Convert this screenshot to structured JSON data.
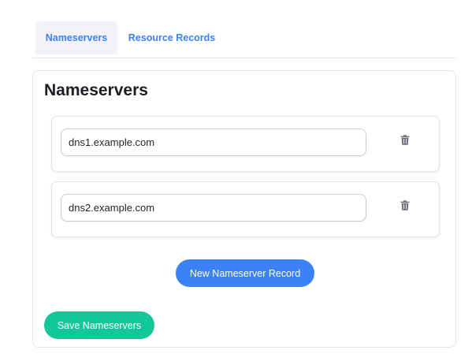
{
  "tabs": [
    {
      "label": "Nameservers",
      "active": true
    },
    {
      "label": "Resource Records",
      "active": false
    }
  ],
  "panel": {
    "title": "Nameservers",
    "records": [
      {
        "value": "dns1.example.com",
        "delete_icon": "trash-icon"
      },
      {
        "value": "dns2.example.com",
        "delete_icon": "trash-icon"
      }
    ],
    "new_button_label": "New Nameserver Record",
    "save_button_label": "Save Nameservers"
  },
  "colors": {
    "accent_blue": "#3b82f6",
    "save_green": "#14c79b",
    "active_tab_bg": "#f1f3f8"
  }
}
